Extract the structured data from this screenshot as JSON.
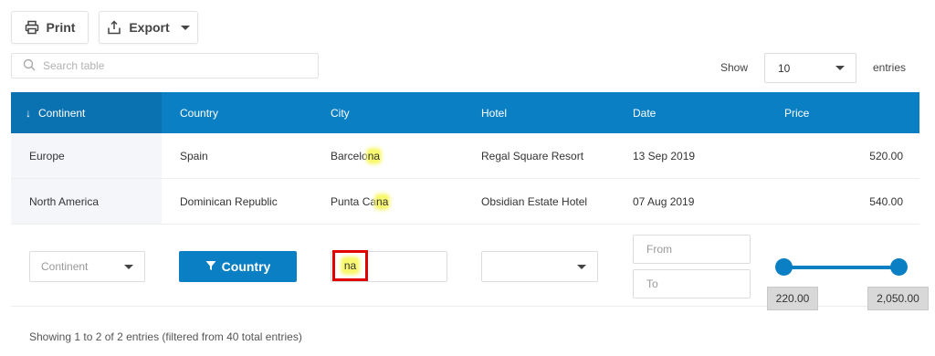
{
  "toolbar": {
    "print_label": "Print",
    "export_label": "Export"
  },
  "search": {
    "placeholder": "Search table"
  },
  "entries": {
    "show_label": "Show",
    "value": "10",
    "suffix": "entries"
  },
  "table": {
    "headers": [
      "Continent",
      "Country",
      "City",
      "Hotel",
      "Date",
      "Price"
    ],
    "sort_indicator": "↓",
    "rows": [
      {
        "continent": "Europe",
        "country": "Spain",
        "city_pre": "Barcelo",
        "city_match": "na",
        "hotel": "Regal Square Resort",
        "date": "13 Sep 2019",
        "price": "520.00"
      },
      {
        "continent": "North America",
        "country": "Dominican Republic",
        "city_pre": "Punta Ca",
        "city_match": "na",
        "hotel": "Obsidian Estate Hotel",
        "date": "07 Aug 2019",
        "price": "540.00"
      }
    ]
  },
  "filters": {
    "continent_placeholder": "Continent",
    "country_button": "Country",
    "city_value": "na",
    "date_from_placeholder": "From",
    "date_to_placeholder": "To",
    "price_min": "220.00",
    "price_max": "2,050.00"
  },
  "info": "Showing 1 to 2 of 2 entries (filtered from 40 total entries)",
  "colors": {
    "header_bg": "#0b7fc3",
    "sorted_header_bg": "#0a72b0",
    "highlight": "#f9f871",
    "focus_border": "#e00000"
  },
  "icons": [
    "printer-icon",
    "export-icon",
    "search-icon",
    "filter-icon",
    "chevron-down-icon",
    "sort-down-icon"
  ]
}
